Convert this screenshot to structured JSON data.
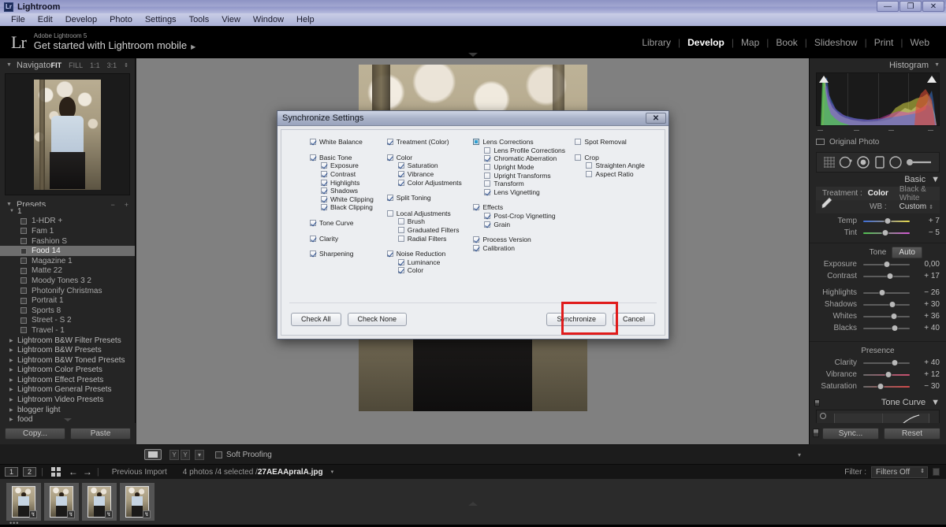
{
  "os": {
    "title": "Lightroom",
    "app_icon": "Lr",
    "minimize": "—",
    "maximize": "❐",
    "close": "✕",
    "menu": [
      "File",
      "Edit",
      "Develop",
      "Photo",
      "Settings",
      "Tools",
      "View",
      "Window",
      "Help"
    ]
  },
  "topbar": {
    "logo": "Lr",
    "product": "Adobe Lightroom 5",
    "headline": "Get started with Lightroom mobile",
    "headline_arrow": "▶",
    "modules": [
      {
        "label": "Library",
        "active": false
      },
      {
        "label": "Develop",
        "active": true
      },
      {
        "label": "Map",
        "active": false
      },
      {
        "label": "Book",
        "active": false
      },
      {
        "label": "Slideshow",
        "active": false
      },
      {
        "label": "Print",
        "active": false
      },
      {
        "label": "Web",
        "active": false
      }
    ]
  },
  "navigator": {
    "title": "Navigator",
    "modes": [
      "FIT",
      "FILL",
      "1:1",
      "3:1"
    ],
    "active_mode": "FIT",
    "spinner": "⇕"
  },
  "presets": {
    "title": "Presets",
    "minus": "−",
    "plus": "+",
    "groups": [
      {
        "label": "1",
        "expanded": true,
        "items": [
          "1-HDR +",
          "Fam 1",
          "Fashion S",
          "Food 14",
          "Magazine 1",
          "Matte 22",
          "Moody Tones 3 2",
          "Photonify Christmas",
          "Portrait 1",
          "Sports 8",
          "Street - S 2",
          "Travel - 1"
        ],
        "selected": "Food 14"
      },
      {
        "label": "Lightroom B&W Filter Presets",
        "expanded": false,
        "items": []
      },
      {
        "label": "Lightroom B&W Presets",
        "expanded": false,
        "items": []
      },
      {
        "label": "Lightroom B&W Toned Presets",
        "expanded": false,
        "items": []
      },
      {
        "label": "Lightroom Color Presets",
        "expanded": false,
        "items": []
      },
      {
        "label": "Lightroom Effect Presets",
        "expanded": false,
        "items": []
      },
      {
        "label": "Lightroom General Presets",
        "expanded": false,
        "items": []
      },
      {
        "label": "Lightroom Video Presets",
        "expanded": false,
        "items": []
      },
      {
        "label": "blogger light",
        "expanded": false,
        "items": []
      },
      {
        "label": "food",
        "expanded": false,
        "items": []
      }
    ]
  },
  "left_footer": {
    "copy_label": "Copy...",
    "paste_label": "Paste"
  },
  "center_toolbar": {
    "view_icon": "loupe-view-icon",
    "compare_icon": "Y",
    "compare_icon2": "Y",
    "caret": "▾",
    "soft_proofing_label": "Soft Proofing",
    "right_caret": "▾"
  },
  "right_panel": {
    "histogram": {
      "title": "Histogram",
      "caret": "▼",
      "original_photo_label": "Original Photo"
    },
    "tools": [
      "crop-overlay-icon",
      "spot-removal-icon",
      "red-eye-icon",
      "graduated-filter-icon",
      "radial-filter-icon",
      "adjustment-brush-icon"
    ],
    "basic": {
      "title": "Basic",
      "caret": "▼",
      "treatment_label": "Treatment :",
      "treatment_color": "Color",
      "treatment_bw": "Black & White",
      "wb_label": "WB :",
      "wb_value": "Custom",
      "wb_spinner": "⇕",
      "wb_sliders": [
        {
          "name": "Temp",
          "value": "+ 7",
          "pos": 52
        },
        {
          "name": "Tint",
          "value": "− 5",
          "pos": 47
        }
      ],
      "tone_title": "Tone",
      "auto_label": "Auto",
      "tone_sliders": [
        {
          "name": "Exposure",
          "value": "0,00",
          "pos": 50
        },
        {
          "name": "Contrast",
          "value": "+ 17",
          "pos": 57
        }
      ],
      "tone_sliders2": [
        {
          "name": "Highlights",
          "value": "− 26",
          "pos": 40
        },
        {
          "name": "Shadows",
          "value": "+ 30",
          "pos": 62
        },
        {
          "name": "Whites",
          "value": "+ 36",
          "pos": 66
        },
        {
          "name": "Blacks",
          "value": "+ 40",
          "pos": 68
        }
      ],
      "presence_title": "Presence",
      "presence_sliders": [
        {
          "name": "Clarity",
          "value": "+ 40",
          "pos": 68
        },
        {
          "name": "Vibrance",
          "value": "+ 12",
          "pos": 55
        },
        {
          "name": "Saturation",
          "value": "− 30",
          "pos": 37
        }
      ]
    },
    "tone_curve": {
      "title": "Tone Curve",
      "caret": "▼"
    },
    "footer": {
      "sync_label": "Sync...",
      "reset_label": "Reset"
    }
  },
  "filmstrip": {
    "page1": "1",
    "page2": "2",
    "grid_icon": "grid-view-icon",
    "back_arrow": "←",
    "forward_arrow": "→",
    "source_label": "Previous Import",
    "count_prefix": "4 photos /4 selected /",
    "filename": "27AEAApralA.jpg",
    "caret": "▾",
    "filter_label": "Filter :",
    "filter_value": "Filters Off",
    "filter_spinner": "⇕",
    "thumbs": [
      {
        "badge": "↯",
        "selected": true
      },
      {
        "badge": "↯",
        "selected": false
      },
      {
        "badge": "↯",
        "selected": false
      },
      {
        "badge": "↯",
        "selected": false
      }
    ]
  },
  "dialog": {
    "title": "Synchronize Settings",
    "close_label": "✕",
    "highlight_color": "#e01b1b",
    "columns": [
      {
        "items": [
          {
            "label": "White Balance",
            "state": "checked",
            "level": 0,
            "gap": "none"
          },
          {
            "label": "Basic Tone",
            "state": "checked",
            "level": 0,
            "gap": "large"
          },
          {
            "label": "Exposure",
            "state": "checked",
            "level": 1,
            "gap": "none"
          },
          {
            "label": "Contrast",
            "state": "checked",
            "level": 1,
            "gap": "none"
          },
          {
            "label": "Highlights",
            "state": "checked",
            "level": 1,
            "gap": "none"
          },
          {
            "label": "Shadows",
            "state": "checked",
            "level": 1,
            "gap": "none"
          },
          {
            "label": "White Clipping",
            "state": "checked",
            "level": 1,
            "gap": "none"
          },
          {
            "label": "Black Clipping",
            "state": "checked",
            "level": 1,
            "gap": "none"
          },
          {
            "label": "Tone Curve",
            "state": "checked",
            "level": 0,
            "gap": "large"
          },
          {
            "label": "Clarity",
            "state": "checked",
            "level": 0,
            "gap": "large"
          },
          {
            "label": "Sharpening",
            "state": "checked",
            "level": 0,
            "gap": "large"
          }
        ]
      },
      {
        "items": [
          {
            "label": "Treatment (Color)",
            "state": "checked",
            "level": 0,
            "gap": "none"
          },
          {
            "label": "Color",
            "state": "checked",
            "level": 0,
            "gap": "large"
          },
          {
            "label": "Saturation",
            "state": "checked",
            "level": 1,
            "gap": "none"
          },
          {
            "label": "Vibrance",
            "state": "checked",
            "level": 1,
            "gap": "none"
          },
          {
            "label": "Color Adjustments",
            "state": "checked",
            "level": 1,
            "gap": "none"
          },
          {
            "label": "Split Toning",
            "state": "checked",
            "level": 0,
            "gap": "large"
          },
          {
            "label": "Local Adjustments",
            "state": "unchecked",
            "level": 0,
            "gap": "large"
          },
          {
            "label": "Brush",
            "state": "unchecked",
            "level": 1,
            "gap": "none"
          },
          {
            "label": "Graduated Filters",
            "state": "unchecked",
            "level": 1,
            "gap": "none"
          },
          {
            "label": "Radial Filters",
            "state": "unchecked",
            "level": 1,
            "gap": "none"
          },
          {
            "label": "Noise Reduction",
            "state": "checked",
            "level": 0,
            "gap": "large"
          },
          {
            "label": "Luminance",
            "state": "checked",
            "level": 1,
            "gap": "none"
          },
          {
            "label": "Color",
            "state": "checked",
            "level": 1,
            "gap": "none"
          }
        ]
      },
      {
        "items": [
          {
            "label": "Lens Corrections",
            "state": "mixed",
            "level": 0,
            "gap": "none"
          },
          {
            "label": "Lens Profile Corrections",
            "state": "unchecked",
            "level": 1,
            "gap": "none"
          },
          {
            "label": "Chromatic Aberration",
            "state": "checked",
            "level": 1,
            "gap": "none"
          },
          {
            "label": "Upright Mode",
            "state": "unchecked",
            "level": 1,
            "gap": "none"
          },
          {
            "label": "Upright Transforms",
            "state": "unchecked",
            "level": 1,
            "gap": "none"
          },
          {
            "label": "Transform",
            "state": "unchecked",
            "level": 1,
            "gap": "none"
          },
          {
            "label": "Lens Vignetting",
            "state": "checked",
            "level": 1,
            "gap": "none"
          },
          {
            "label": "Effects",
            "state": "checked",
            "level": 0,
            "gap": "large"
          },
          {
            "label": "Post-Crop Vignetting",
            "state": "checked",
            "level": 1,
            "gap": "none"
          },
          {
            "label": "Grain",
            "state": "checked",
            "level": 1,
            "gap": "none"
          },
          {
            "label": "Process Version",
            "state": "checked",
            "level": 0,
            "gap": "large"
          },
          {
            "label": "Calibration",
            "state": "checked",
            "level": 0,
            "gap": "none"
          }
        ]
      },
      {
        "items": [
          {
            "label": "Spot Removal",
            "state": "unchecked",
            "level": 0,
            "gap": "none"
          },
          {
            "label": "Crop",
            "state": "unchecked",
            "level": 0,
            "gap": "large"
          },
          {
            "label": "Straighten Angle",
            "state": "unchecked",
            "level": 1,
            "gap": "none"
          },
          {
            "label": "Aspect Ratio",
            "state": "unchecked",
            "level": 1,
            "gap": "none"
          }
        ]
      }
    ],
    "buttons": {
      "check_all": "Check All",
      "check_none": "Check None",
      "synchronize": "Synchronize",
      "cancel": "Cancel"
    }
  }
}
